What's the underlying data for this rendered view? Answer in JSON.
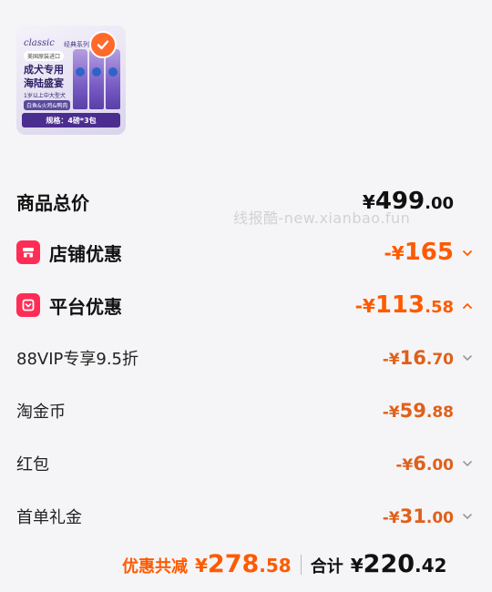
{
  "product": {
    "brand": "classic",
    "series": "经典系列",
    "origin": "美国原装进口",
    "title_line1": "成犬专用",
    "title_line2": "海陆盛宴",
    "subtitle": "1岁以上中大型犬",
    "flavor": "白鱼&火鸡&鸭肉",
    "spec": "规格：4磅*3包"
  },
  "watermark": "线报酷-new.xianbao.fun",
  "total": {
    "label": "商品总价",
    "currency": "¥",
    "int": "499",
    "dec": ".00"
  },
  "shop_discount": {
    "label": "店铺优惠",
    "icon": "shop-icon",
    "sign": "-¥",
    "int": "165",
    "dec": "",
    "chevron": "chevron-down-icon"
  },
  "platform_discount": {
    "label": "平台优惠",
    "icon": "platform-icon",
    "sign": "-¥",
    "int": "113",
    "dec": ".58",
    "chevron": "chevron-up-icon"
  },
  "sub_items": [
    {
      "label": "88VIP专享9.5折",
      "sign": "-¥",
      "int": "16",
      "dec": ".70",
      "chevron": "chevron-down-icon"
    },
    {
      "label": "淘金币",
      "sign": "-¥",
      "int": "59",
      "dec": ".88",
      "chevron": ""
    },
    {
      "label": "红包",
      "sign": "-¥",
      "int": "6",
      "dec": ".00",
      "chevron": "chevron-down-icon"
    },
    {
      "label": "首单礼金",
      "sign": "-¥",
      "int": "31",
      "dec": ".00",
      "chevron": "chevron-down-icon"
    }
  ],
  "footer": {
    "discount_label": "优惠共减",
    "discount_currency": "¥",
    "discount_int": "278",
    "discount_dec": ".58",
    "total_label": "合计",
    "total_currency": "¥",
    "total_int": "220",
    "total_dec": ".42"
  },
  "colors": {
    "accent": "#ff5a00",
    "badge": "#ff2d55",
    "check": "#ff6a2a",
    "background": "#f5f5f7"
  }
}
